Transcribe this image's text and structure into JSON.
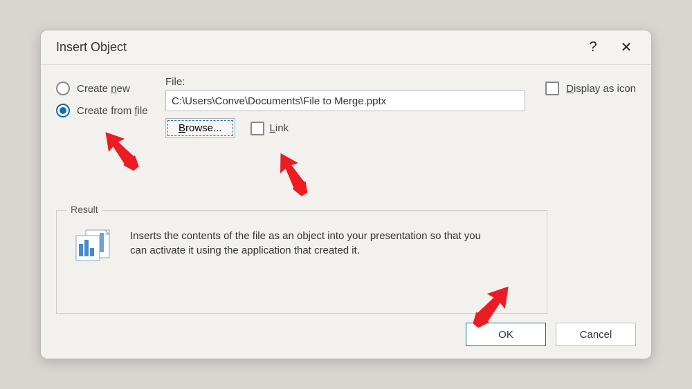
{
  "dialog": {
    "title": "Insert Object",
    "help_glyph": "?",
    "close_glyph": "✕"
  },
  "radios": {
    "create_new": "Create new",
    "create_new_accel": "n",
    "create_from_file": "Create from file",
    "create_from_file_accel": "f",
    "selected": "create_from_file"
  },
  "file": {
    "label": "File:",
    "path": "C:\\Users\\Conve\\Documents\\File to Merge.pptx",
    "browse": "Browse...",
    "browse_accel": "B",
    "link": "Link",
    "link_accel": "L",
    "link_checked": false
  },
  "display_as_icon": {
    "label": "Display as icon",
    "accel": "D",
    "checked": false
  },
  "result": {
    "legend": "Result",
    "text": "Inserts the contents of the file as an object into your presentation so that you can activate it using the application that created it."
  },
  "buttons": {
    "ok": "OK",
    "cancel": "Cancel"
  },
  "colors": {
    "accent": "#0f6cbd",
    "arrow": "#ec1c24"
  }
}
